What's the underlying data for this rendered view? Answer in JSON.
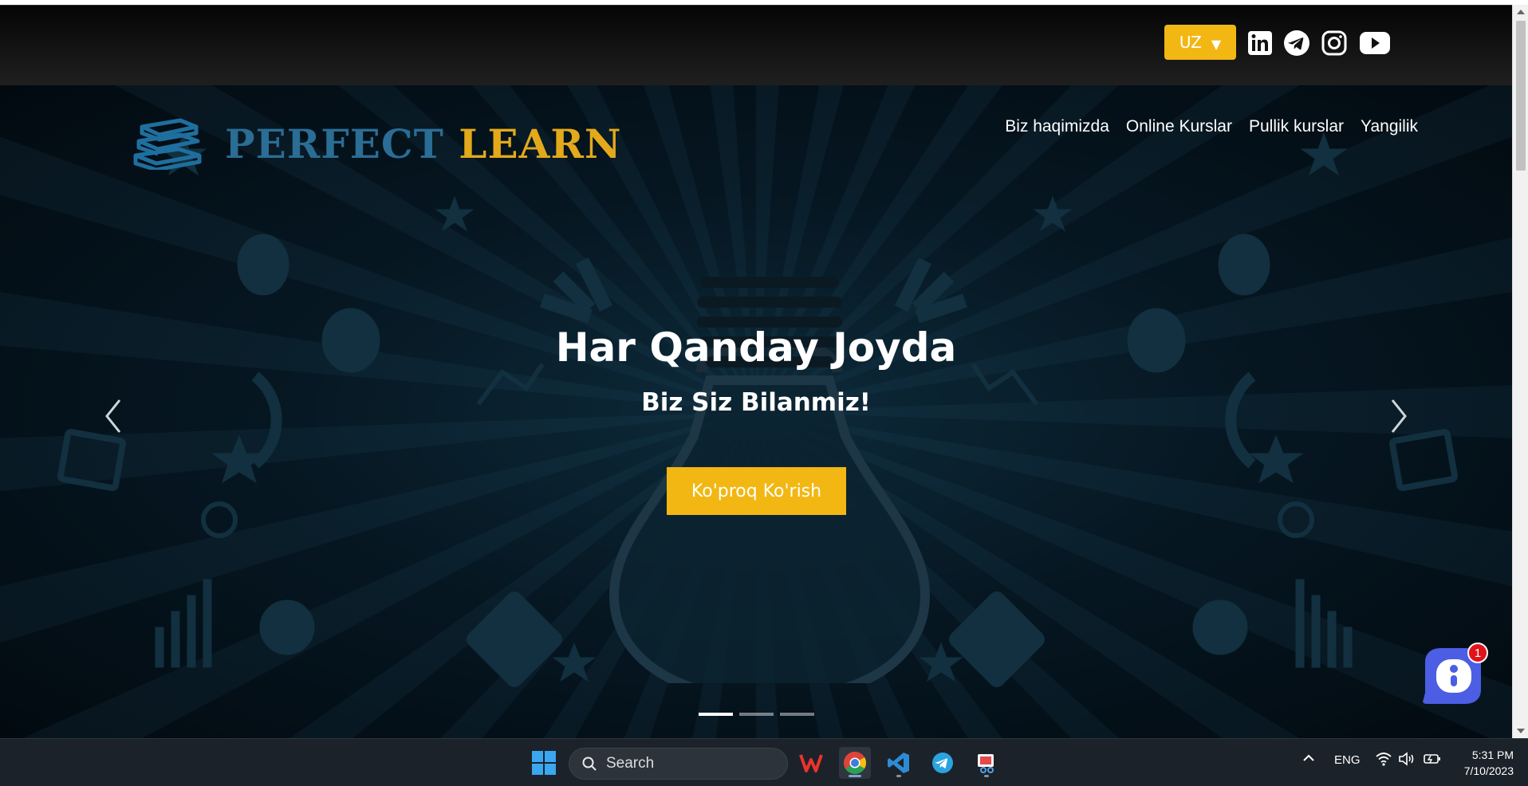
{
  "header": {
    "language": "UZ",
    "social_icons": [
      "linkedin-icon",
      "telegram-icon",
      "instagram-icon",
      "youtube-icon"
    ]
  },
  "logo": {
    "word1": "PERFECT",
    "word2": "LEARN"
  },
  "nav": {
    "items": [
      "Biz haqimizda",
      "Online Kurslar",
      "Pullik kurslar",
      "Yangilik"
    ]
  },
  "hero": {
    "title": "Har Qanday Joyda",
    "subtitle": "Biz Siz Bilanmiz!",
    "cta": "Ko'proq Ko'rish",
    "slide_count": 3,
    "active_slide": 1
  },
  "chat": {
    "badge": "1"
  },
  "taskbar": {
    "search_label": "Search",
    "language": "ENG",
    "time": "5:31 PM",
    "date": "7/10/2023"
  },
  "colors": {
    "accent": "#f2b712",
    "logo_blue": "#2a6d95",
    "logo_gold": "#e3a91b",
    "hero_bg": "#061722",
    "chat_blue": "#4b5ee4"
  }
}
